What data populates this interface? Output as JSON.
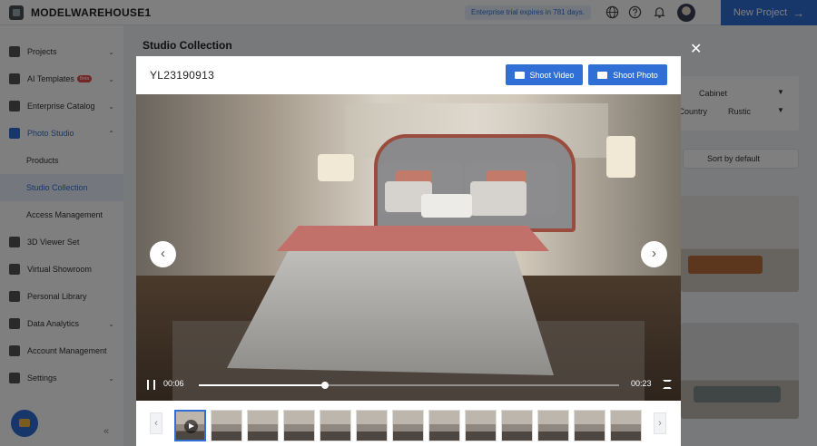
{
  "header": {
    "brand": "MODELWAREHOUSE1",
    "trial_notice": "Enterprise trial expires in 781 days.",
    "new_project_label": "New Project",
    "new_project_arrow": "→",
    "icons": [
      "globe-icon",
      "help-icon",
      "bell-icon",
      "avatar"
    ]
  },
  "sidebar": {
    "items": [
      {
        "label": "Projects",
        "icon": "folder-icon",
        "chevron": "⌄"
      },
      {
        "label": "AI Templates",
        "icon": "ai-icon",
        "badge": "Beta",
        "chevron": "⌄"
      },
      {
        "label": "Enterprise Catalog",
        "icon": "crown-icon",
        "chevron": "⌄"
      },
      {
        "label": "Photo Studio",
        "icon": "camera-icon",
        "chevron": "⌃"
      },
      {
        "label": "Products"
      },
      {
        "label": "Studio Collection"
      },
      {
        "label": "Access Management"
      },
      {
        "label": "3D Viewer Set",
        "icon": "cube-icon"
      },
      {
        "label": "Virtual Showroom",
        "icon": "showroom-icon"
      },
      {
        "label": "Personal Library",
        "icon": "library-icon"
      },
      {
        "label": "Data Analytics",
        "icon": "chart-icon",
        "chevron": "⌄"
      },
      {
        "label": "Account Management",
        "icon": "user-icon"
      },
      {
        "label": "Settings",
        "icon": "gear-icon",
        "chevron": "⌄"
      }
    ],
    "collapse_glyph": "«"
  },
  "main": {
    "page_title": "Studio Collection",
    "filters": {
      "filter1_value": "Cabinet",
      "filter2_label": "n Country",
      "filter2_value": "Rustic"
    },
    "sort_label": "Sort by default"
  },
  "modal": {
    "title": "YL23190913",
    "shoot_video_label": "Shoot Video",
    "shoot_photo_label": "Shoot Photo",
    "close_glyph": "✕",
    "prev_glyph": "‹",
    "next_glyph": "›",
    "video": {
      "current_time": "00:06",
      "total_time": "00:23",
      "progress": 0.3
    },
    "thumbnail_count": 13,
    "selected_thumbnail": 1
  },
  "colors": {
    "accent": "#2f6fd6",
    "badge": "#e84d4d"
  }
}
